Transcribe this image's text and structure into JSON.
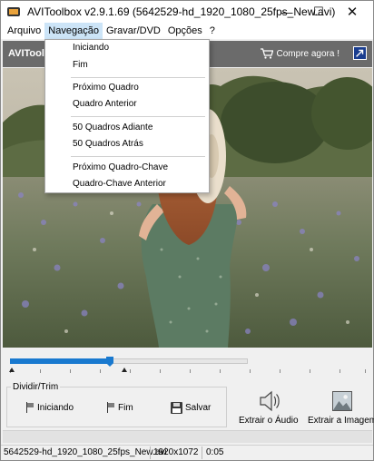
{
  "window": {
    "title": "AVIToolbox v2.9.1.69 (5642529-hd_1920_1080_25fps_New.avi)",
    "minimize_glyph": "—",
    "maximize_glyph": "☐",
    "close_glyph": "✕"
  },
  "menubar": {
    "items": [
      "Arquivo",
      "Navegação",
      "Gravar/DVD",
      "Opções",
      "?"
    ]
  },
  "toolbar": {
    "brand": "AVITool",
    "buy_label": "Compre agora !"
  },
  "navigation_menu": {
    "items": [
      "Iniciando",
      "Fim",
      "Próximo Quadro",
      "Quadro Anterior",
      "50 Quadros Adiante",
      "50 Quadros Atrás",
      "Próximo Quadro-Chave",
      "Quadro-Chave Anterior"
    ]
  },
  "slider": {
    "position_fraction": 0.42
  },
  "trim": {
    "title": "Dividir/Trim",
    "start_label": "Iniciando",
    "end_label": "Fim",
    "save_label": "Salvar"
  },
  "actions": {
    "extract_audio_label": "Extrair o Áudio",
    "extract_image_label": "Extrair a Imagem"
  },
  "statusbar": {
    "file": "5642529-hd_1920_1080_25fps_New.avi",
    "resolution": "1920x1072",
    "duration": "0:05"
  },
  "colors": {
    "accent": "#1979cf",
    "menu_highlight": "#cce4f7",
    "toolbar_bg": "#6b6b6b"
  }
}
